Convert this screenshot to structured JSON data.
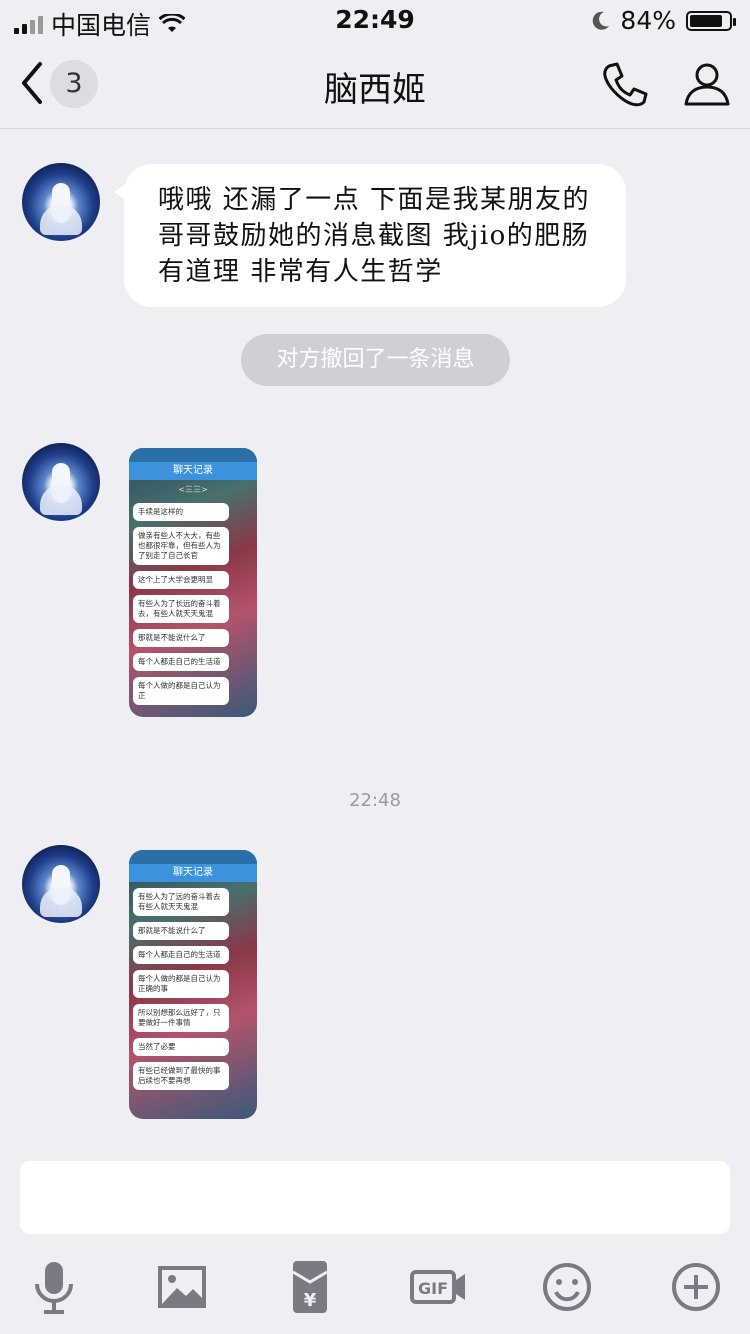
{
  "status_bar": {
    "carrier": "中国电信",
    "time": "22:49",
    "battery": "84%",
    "battery_level": 0.84
  },
  "nav": {
    "unread_count": "3",
    "title": "脑西姬"
  },
  "messages": {
    "text": "哦哦 还漏了一点 下面是我某朋友的哥哥鼓励她的消息截图 我jio的肥肠有道理 非常有人生哲学",
    "recall_notice": "对方撤回了一条消息",
    "timestamp": "22:48"
  },
  "thumbnail_1": {
    "header": "聊天记录",
    "sub": "<三三>",
    "lines": [
      "手续是这样的",
      "做亲有些人不大大，有些也都很牢靠，但有些人为了别走了自己长官",
      "这个上了大学会更明显",
      "有些人为了长远的奋斗着去，有些人就天天鬼混",
      "那就是不能说什么了",
      "每个人都走自己的生活道",
      "每个人做的都是自己认为正"
    ]
  },
  "thumbnail_2": {
    "header": "聊天记录",
    "lines": [
      "有些人为了远的奋斗着去有些人就天天鬼混",
      "那就是不能说什么了",
      "每个人都走自己的生活道",
      "每个人做的都是自己认为正确的事",
      "所以别想那么远好了，只要做好一件事情",
      "当然了必要",
      "有些已经做到了最快的事后续也不要再想"
    ]
  },
  "icons": [
    "microphone-icon",
    "image-icon",
    "red-packet-icon",
    "gif-icon",
    "emoji-icon",
    "plus-icon"
  ],
  "colors": {
    "background": "#eeeef3",
    "bubble": "#ffffff",
    "icon_gray": "#7a7a82",
    "recall_pill": "#cfcfd6"
  }
}
